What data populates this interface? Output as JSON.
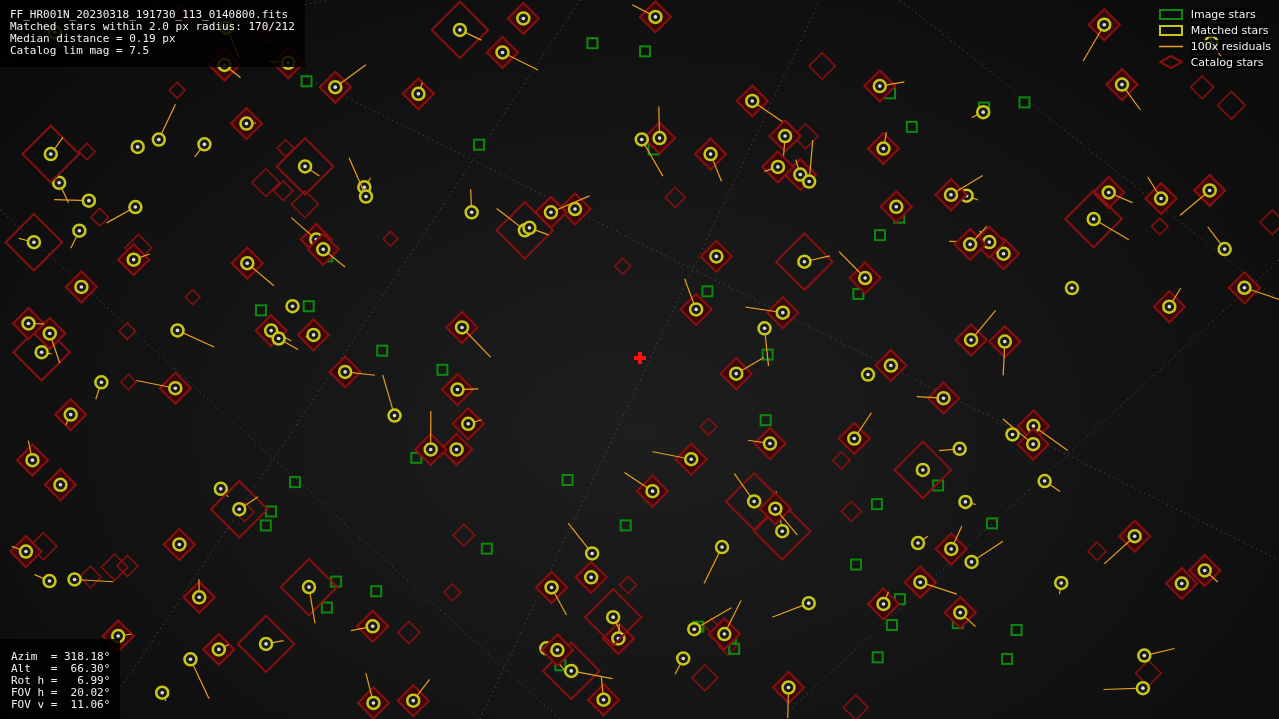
{
  "info_panel": {
    "lines": [
      "FF_HR001N_20230318_191730_113_0140800.fits",
      "Matched stars within 2.0 px radius: 170/212",
      "Median distance = 0.19 px",
      "Catalog lim mag = 7.5"
    ]
  },
  "legend": {
    "items": [
      {
        "kind": "image",
        "label": "Image stars"
      },
      {
        "kind": "matched",
        "label": "Matched stars"
      },
      {
        "kind": "residual",
        "label": "100x residuals"
      },
      {
        "kind": "catalog",
        "label": "Catalog stars"
      }
    ]
  },
  "pointing_panel": {
    "lines": [
      "Azim  = 318.18°",
      "Alt   =  66.30°",
      "Rot h =   6.99°",
      "FOV h =  20.02°",
      "FOV v =  11.06°"
    ]
  }
}
